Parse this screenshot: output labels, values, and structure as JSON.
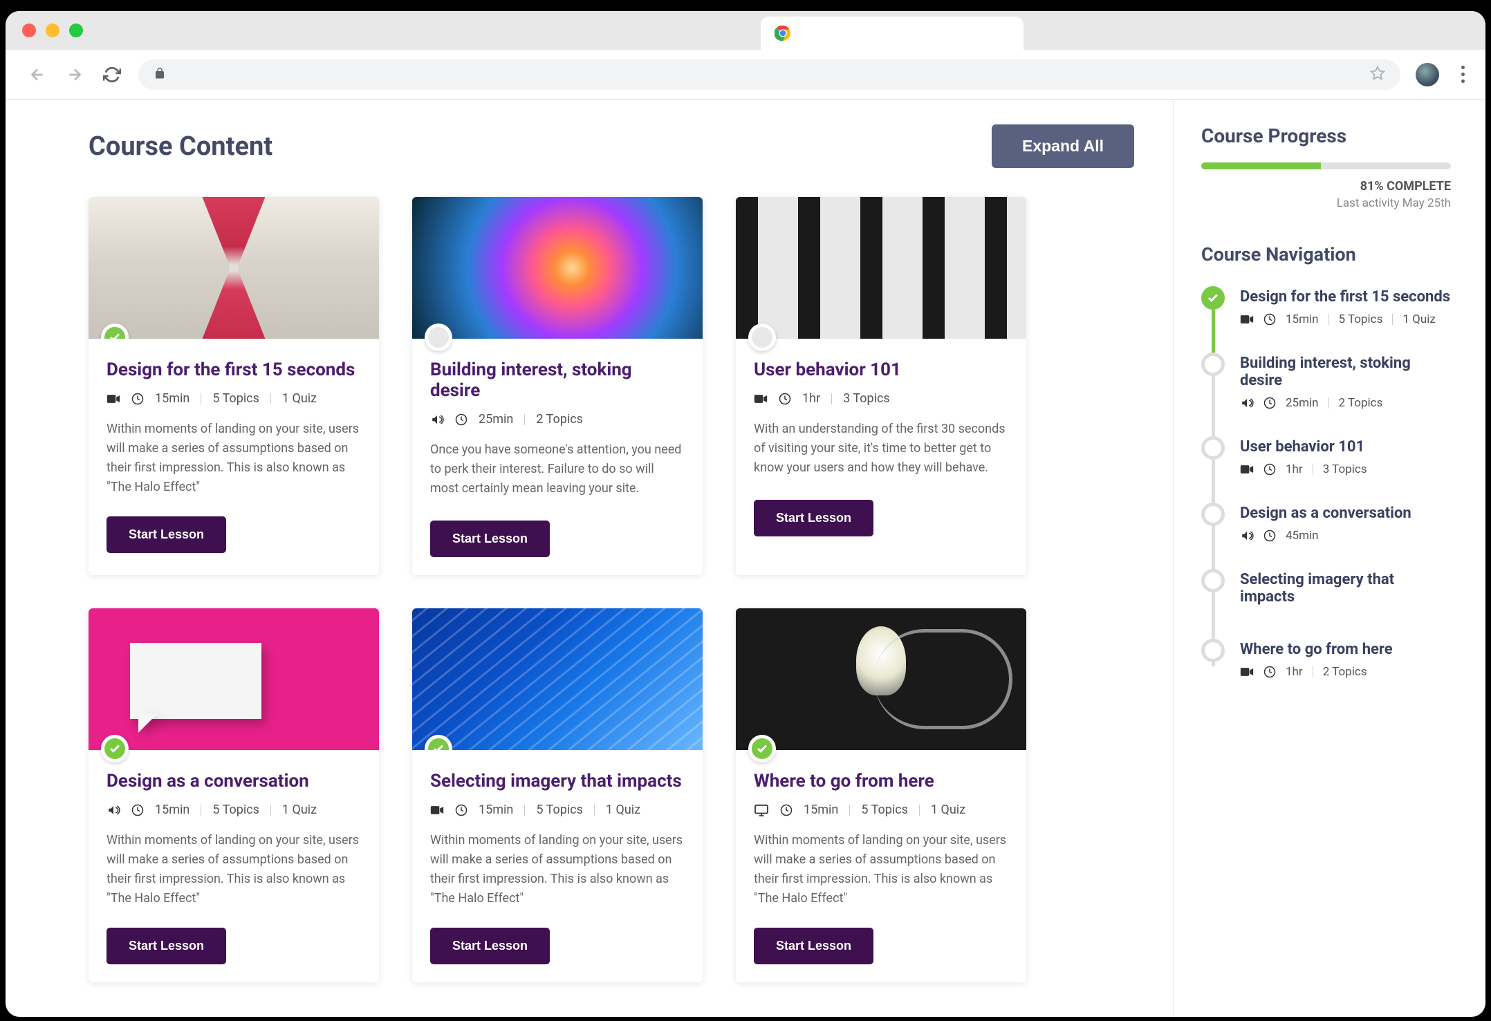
{
  "header": {
    "title": "Course Content",
    "expand_label": "Expand All"
  },
  "progress": {
    "title": "Course Progress",
    "percent": 81,
    "percent_width": "48%",
    "complete_label": "81% COMPLETE",
    "last_activity": "Last activity May 25th"
  },
  "nav_title": "Course Navigation",
  "cards": [
    {
      "title": "Design for the first 15 seconds",
      "icon": "video",
      "duration": "15min",
      "topics": "5 Topics",
      "quiz": "1 Quiz",
      "desc": "Within moments of landing on your site, users will make a series of assumptions based on their first impression. This is also known as \"The Halo Effect\"",
      "button": "Start Lesson",
      "status": "done",
      "img": "hourglass"
    },
    {
      "title": "Building interest, stoking desire",
      "icon": "audio",
      "duration": "25min",
      "topics": "2 Topics",
      "quiz": "",
      "desc": "Once you have someone's attention, you need to perk their interest. Failure to do so will most certainly mean leaving your site.",
      "button": "Start Lesson",
      "status": "pending",
      "img": "sparkler"
    },
    {
      "title": "User behavior 101",
      "icon": "video",
      "duration": "1hr",
      "topics": "3 Topics",
      "quiz": "",
      "desc": "With an understanding of the first 30 seconds of visiting your site, it's time to better get to know your users and how they will behave.",
      "button": "Start Lesson",
      "status": "pending",
      "img": "doors"
    },
    {
      "title": "Design as a conversation",
      "icon": "audio",
      "duration": "15min",
      "topics": "5 Topics",
      "quiz": "1 Quiz",
      "desc": "Within moments of landing on your site, users will make a series of assumptions based on their first impression. This is also known as \"The Halo Effect\"",
      "button": "Start Lesson",
      "status": "done",
      "img": "speech"
    },
    {
      "title": "Selecting imagery that impacts",
      "icon": "video",
      "duration": "15min",
      "topics": "5 Topics",
      "quiz": "1 Quiz",
      "desc": "Within moments of landing on your site, users will make a series of assumptions based on their first impression. This is also known as \"The Halo Effect\"",
      "button": "Start Lesson",
      "status": "done",
      "img": "lines"
    },
    {
      "title": "Where to go from here",
      "icon": "desktop",
      "duration": "15min",
      "topics": "5 Topics",
      "quiz": "1 Quiz",
      "desc": "Within moments of landing on your site, users will make a series of assumptions based on their first impression. This is also known as \"The Halo Effect\"",
      "button": "Start Lesson",
      "status": "done",
      "img": "bulb"
    }
  ],
  "nav_items": [
    {
      "title": "Design for the first 15 seconds",
      "icon": "video",
      "duration": "15min",
      "topics": "5 Topics",
      "quiz": "1 Quiz",
      "done": true
    },
    {
      "title": "Building interest, stoking desire",
      "icon": "audio",
      "duration": "25min",
      "topics": "2 Topics",
      "quiz": "",
      "done": false
    },
    {
      "title": "User behavior 101",
      "icon": "video",
      "duration": "1hr",
      "topics": "3 Topics",
      "quiz": "",
      "done": false
    },
    {
      "title": "Design as a conversation",
      "icon": "audio",
      "duration": "45min",
      "topics": "",
      "quiz": "",
      "done": false
    },
    {
      "title": "Selecting imagery that impacts",
      "icon": "",
      "duration": "",
      "topics": "",
      "quiz": "",
      "done": false
    },
    {
      "title": "Where to go from here",
      "icon": "video",
      "duration": "1hr",
      "topics": "2 Topics",
      "quiz": "",
      "done": false
    }
  ]
}
